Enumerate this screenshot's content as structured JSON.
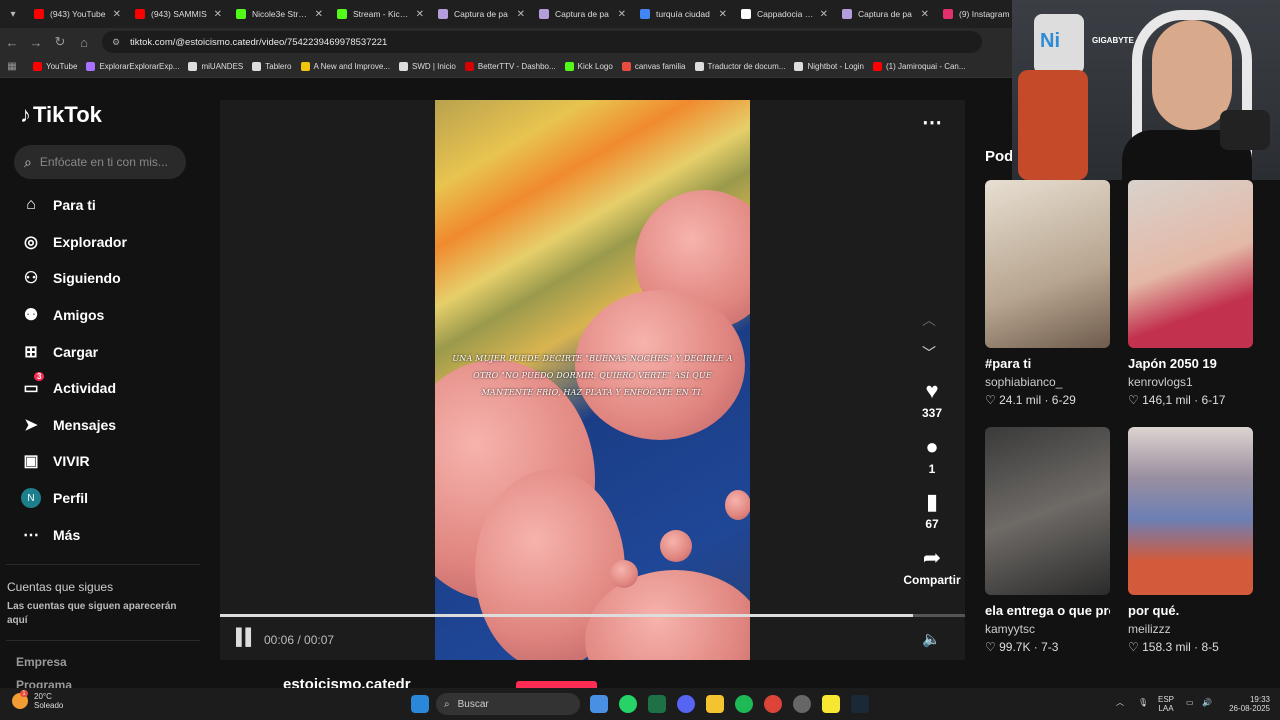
{
  "browser": {
    "tabs": [
      {
        "title": "(943) YouTube",
        "color": "#ff0000"
      },
      {
        "title": "(943) SAMMIS",
        "color": "#ff0000"
      },
      {
        "title": "Nicole3e Stream",
        "color": "#53fc18"
      },
      {
        "title": "Stream - Kick D",
        "color": "#53fc18"
      },
      {
        "title": "Captura de pa",
        "color": "#b39ddb"
      },
      {
        "title": "Captura de pa",
        "color": "#b39ddb"
      },
      {
        "title": "turquía ciudad",
        "color": "#4285f4"
      },
      {
        "title": "Cappadocia Hu",
        "color": "#ffffff"
      },
      {
        "title": "Captura de pa",
        "color": "#b39ddb"
      },
      {
        "title": "(9) Instagram",
        "color": "#e1306c"
      }
    ],
    "url": "tiktok.com/@estoicismo.catedr/video/7542239469978537221",
    "bookmarks": [
      {
        "label": "YouTube",
        "color": "#ff0000"
      },
      {
        "label": "ExplorarExplorarExp...",
        "color": "#a970ff"
      },
      {
        "label": "miUANDES",
        "color": "#dddddd"
      },
      {
        "label": "Tablero",
        "color": "#dddddd"
      },
      {
        "label": "A New and Improve...",
        "color": "#f1c40f"
      },
      {
        "label": "SWD | Inicio",
        "color": "#dddddd"
      },
      {
        "label": "BetterTTV - Dashbo...",
        "color": "#d50000"
      },
      {
        "label": "Kick Logo",
        "color": "#53fc18"
      },
      {
        "label": "canvas familia",
        "color": "#e74c3c"
      },
      {
        "label": "Traductor de docum...",
        "color": "#dddddd"
      },
      {
        "label": "Nightbot - Login",
        "color": "#dddddd"
      },
      {
        "label": "(1) Jamiroquai - Can...",
        "color": "#ff0000"
      }
    ]
  },
  "sidebar": {
    "logo": "TikTok",
    "search_placeholder": "Enfócate en ti con mis...",
    "items": [
      {
        "label": "Para ti",
        "icon": "home-icon"
      },
      {
        "label": "Explorador",
        "icon": "compass-icon"
      },
      {
        "label": "Siguiendo",
        "icon": "following-icon"
      },
      {
        "label": "Amigos",
        "icon": "friends-icon"
      },
      {
        "label": "Cargar",
        "icon": "upload-icon"
      },
      {
        "label": "Actividad",
        "icon": "activity-icon",
        "badge": "3"
      },
      {
        "label": "Mensajes",
        "icon": "send-icon"
      },
      {
        "label": "VIVIR",
        "icon": "live-icon"
      },
      {
        "label": "Perfil",
        "icon": "avatar",
        "avatar_letter": "N"
      },
      {
        "label": "Más",
        "icon": "more-icon"
      }
    ],
    "following_title": "Cuentas que sigues",
    "following_sub": "Las cuentas que siguen aparecerán aquí",
    "footer": [
      "Empresa",
      "Programa"
    ]
  },
  "video": {
    "caption": "UNA MUJER PUEDE DECIRTE \"BUENAS NOCHES\" Y DECIRLE A OTRO \"NO PUEDO DORMIR, QUIERO VERTE\" ASÍ QUE MANTENTE FRÍO, HAZ PLATA Y ENFÓCATE EN TI.",
    "time": "00:06 / 00:07",
    "progress_fraction": 0.93,
    "author": "estoicismo.catedr",
    "actions": [
      {
        "icon": "heart-icon",
        "count": "337"
      },
      {
        "icon": "comment-icon",
        "count": "1"
      },
      {
        "icon": "bookmark-icon",
        "count": "67"
      },
      {
        "icon": "share-icon",
        "count": "Compartir"
      }
    ]
  },
  "recommend": {
    "title": "Pod",
    "cards": [
      {
        "title": "#para ti",
        "user": "sophiabianco_",
        "stats": "♡ 24.1 mil · 6-29"
      },
      {
        "title": "Japón 2050 19",
        "user": "kenrovlogs1",
        "stats": "♡ 146,1 mil · 6-17"
      },
      {
        "title": "ela entrega o que promete @Sophia...",
        "user": "kamyytsc",
        "stats": "♡ 99.7K · 7-3"
      },
      {
        "title": "por qué.",
        "user": "meilizzz",
        "stats": "♡ 158.3 mil · 8-5"
      }
    ]
  },
  "webcam": {
    "brand": "GIGABYTE"
  },
  "taskbar": {
    "temp": "20°C",
    "weather": "Soleado",
    "weather_badge": "1",
    "search": "Buscar",
    "lang": "ESP",
    "lang2": "LAA",
    "time": "19:33",
    "date": "26-08-2025"
  }
}
